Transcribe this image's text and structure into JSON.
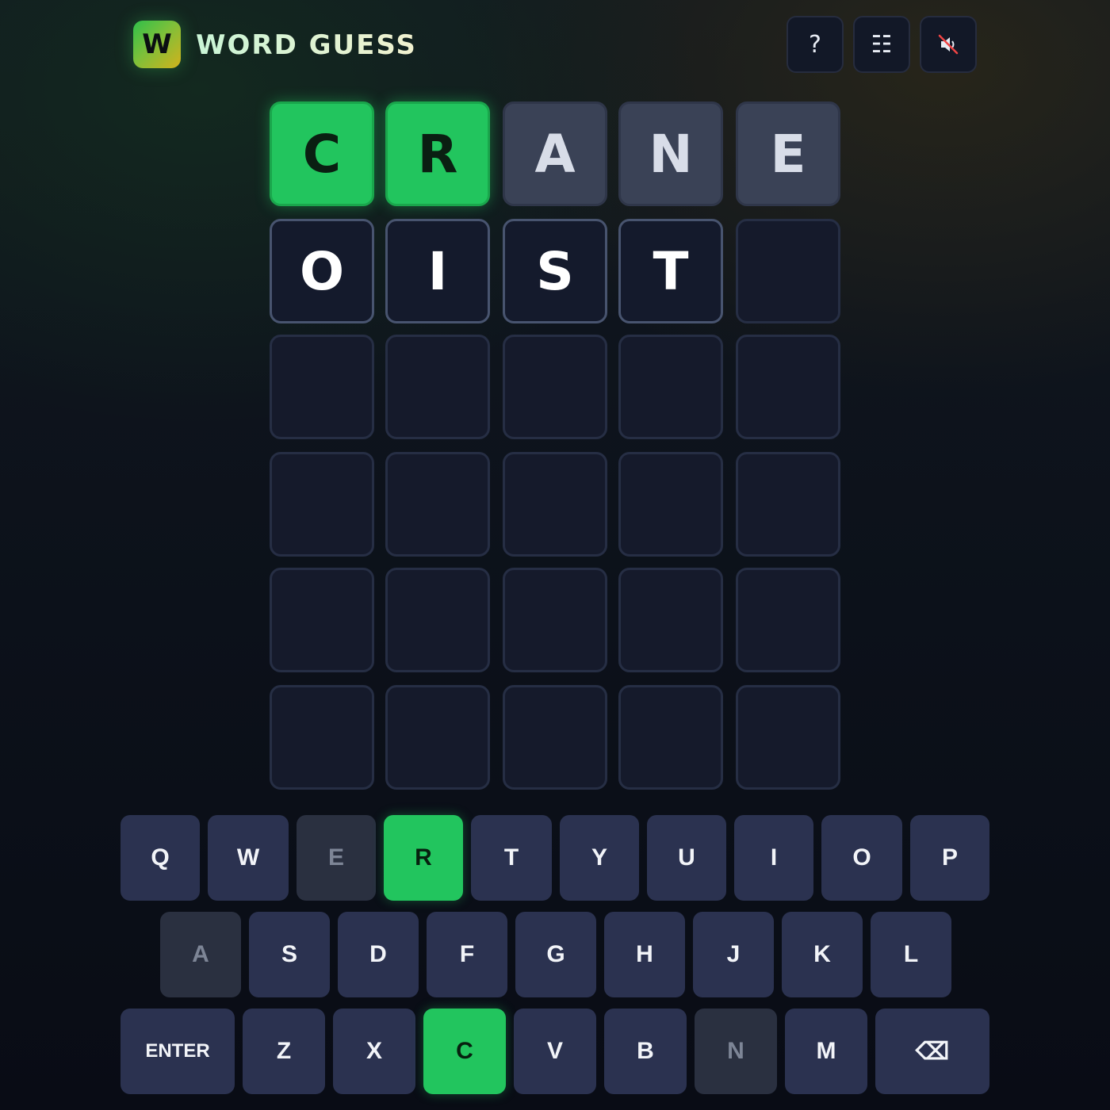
{
  "header": {
    "logo_letter": "W",
    "title": "WORD GUESS",
    "buttons": [
      {
        "name": "help-button",
        "label": "?",
        "icon": "question-mark-icon"
      },
      {
        "name": "stats-button",
        "label": "☷",
        "icon": "stats-grid-icon"
      },
      {
        "name": "sound-button",
        "label": "",
        "icon": "speaker-muted-icon"
      }
    ]
  },
  "board": {
    "rows": [
      [
        {
          "letter": "C",
          "state": "correct"
        },
        {
          "letter": "R",
          "state": "correct"
        },
        {
          "letter": "A",
          "state": "absent"
        },
        {
          "letter": "N",
          "state": "absent"
        },
        {
          "letter": "E",
          "state": "absent"
        }
      ],
      [
        {
          "letter": "O",
          "state": "typed"
        },
        {
          "letter": "I",
          "state": "typed"
        },
        {
          "letter": "S",
          "state": "typed"
        },
        {
          "letter": "T",
          "state": "typed"
        },
        {
          "letter": "",
          "state": "empty"
        }
      ],
      [
        {
          "letter": "",
          "state": "empty"
        },
        {
          "letter": "",
          "state": "empty"
        },
        {
          "letter": "",
          "state": "empty"
        },
        {
          "letter": "",
          "state": "empty"
        },
        {
          "letter": "",
          "state": "empty"
        }
      ],
      [
        {
          "letter": "",
          "state": "empty"
        },
        {
          "letter": "",
          "state": "empty"
        },
        {
          "letter": "",
          "state": "empty"
        },
        {
          "letter": "",
          "state": "empty"
        },
        {
          "letter": "",
          "state": "empty"
        }
      ],
      [
        {
          "letter": "",
          "state": "empty"
        },
        {
          "letter": "",
          "state": "empty"
        },
        {
          "letter": "",
          "state": "empty"
        },
        {
          "letter": "",
          "state": "empty"
        },
        {
          "letter": "",
          "state": "empty"
        }
      ],
      [
        {
          "letter": "",
          "state": "empty"
        },
        {
          "letter": "",
          "state": "empty"
        },
        {
          "letter": "",
          "state": "empty"
        },
        {
          "letter": "",
          "state": "empty"
        },
        {
          "letter": "",
          "state": "empty"
        }
      ]
    ]
  },
  "keyboard": {
    "rows": [
      [
        {
          "label": "Q",
          "state": "normal"
        },
        {
          "label": "W",
          "state": "normal"
        },
        {
          "label": "E",
          "state": "absent"
        },
        {
          "label": "R",
          "state": "correct"
        },
        {
          "label": "T",
          "state": "normal"
        },
        {
          "label": "Y",
          "state": "normal"
        },
        {
          "label": "U",
          "state": "normal"
        },
        {
          "label": "I",
          "state": "normal"
        },
        {
          "label": "O",
          "state": "normal"
        },
        {
          "label": "P",
          "state": "normal"
        }
      ],
      [
        {
          "label": "A",
          "state": "absent"
        },
        {
          "label": "S",
          "state": "normal"
        },
        {
          "label": "D",
          "state": "normal"
        },
        {
          "label": "F",
          "state": "normal"
        },
        {
          "label": "G",
          "state": "normal"
        },
        {
          "label": "H",
          "state": "normal"
        },
        {
          "label": "J",
          "state": "normal"
        },
        {
          "label": "K",
          "state": "normal"
        },
        {
          "label": "L",
          "state": "normal"
        }
      ],
      [
        {
          "label": "ENTER",
          "state": "normal"
        },
        {
          "label": "Z",
          "state": "normal"
        },
        {
          "label": "X",
          "state": "normal"
        },
        {
          "label": "C",
          "state": "correct"
        },
        {
          "label": "V",
          "state": "normal"
        },
        {
          "label": "B",
          "state": "normal"
        },
        {
          "label": "N",
          "state": "absent"
        },
        {
          "label": "M",
          "state": "normal"
        },
        {
          "label": "⌫",
          "state": "normal"
        }
      ]
    ]
  },
  "colors": {
    "correct": "#22c55e",
    "absent_tile": "#3a4256",
    "absent_key": "#2a3040",
    "key": "#2b3250",
    "empty_tile": "#151a2b"
  }
}
